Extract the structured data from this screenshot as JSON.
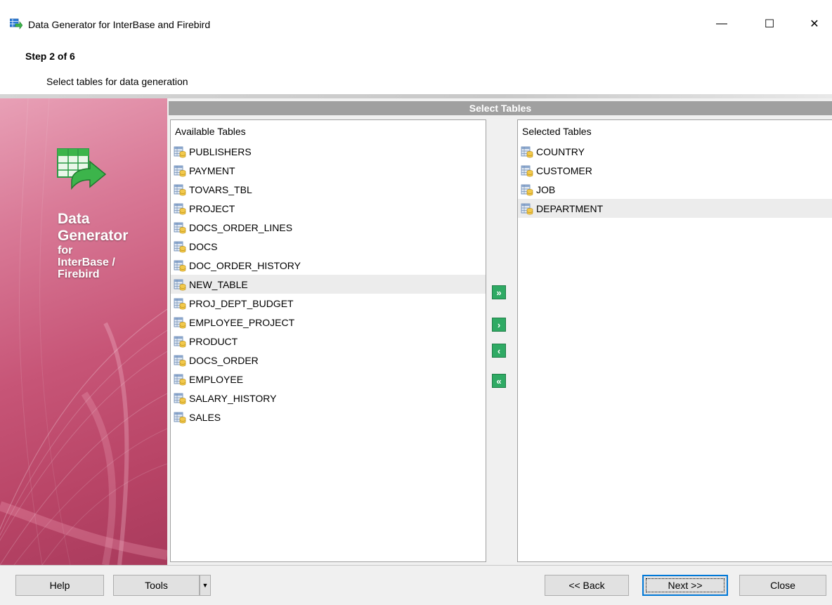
{
  "window": {
    "title": "Data Generator for InterBase and Firebird",
    "minimize_glyph": "—",
    "maximize_glyph": "☐",
    "close_glyph": "✕"
  },
  "header": {
    "step": "Step 2 of 6",
    "description": "Select tables for data generation"
  },
  "banner": {
    "line1": "Data",
    "line2": "Generator",
    "line3": "for",
    "line4": "InterBase /",
    "line5": "Firebird"
  },
  "section": {
    "title": "Select Tables"
  },
  "available": {
    "title": "Available Tables",
    "items": [
      "PUBLISHERS",
      "PAYMENT",
      "TOVARS_TBL",
      "PROJECT",
      "DOCS_ORDER_LINES",
      "DOCS",
      "DOC_ORDER_HISTORY",
      "NEW_TABLE",
      "PROJ_DEPT_BUDGET",
      "EMPLOYEE_PROJECT",
      "PRODUCT",
      "DOCS_ORDER",
      "EMPLOYEE",
      "SALARY_HISTORY",
      "SALES"
    ],
    "highlighted_item": "NEW_TABLE"
  },
  "selected": {
    "title": "Selected Tables",
    "items": [
      "COUNTRY",
      "CUSTOMER",
      "JOB",
      "DEPARTMENT"
    ],
    "highlighted_item": "DEPARTMENT"
  },
  "arrows": {
    "add_all": "»",
    "add": "›",
    "remove": "‹",
    "remove_all": "«"
  },
  "footer": {
    "help": "Help",
    "tools": "Tools",
    "tools_dropdown": "▼",
    "back": "<< Back",
    "next": "Next >>",
    "close": "Close"
  },
  "colors": {
    "banner_start": "#e8a0b6",
    "banner_end": "#a83a5c",
    "section_bar": "#a0a0a0",
    "arrow_button": "#2faa64",
    "default_button_border": "#0078d7"
  },
  "icons": {
    "app": "data-generator-icon",
    "table": "table-icon",
    "banner_logo": "data-generator-logo-icon"
  }
}
